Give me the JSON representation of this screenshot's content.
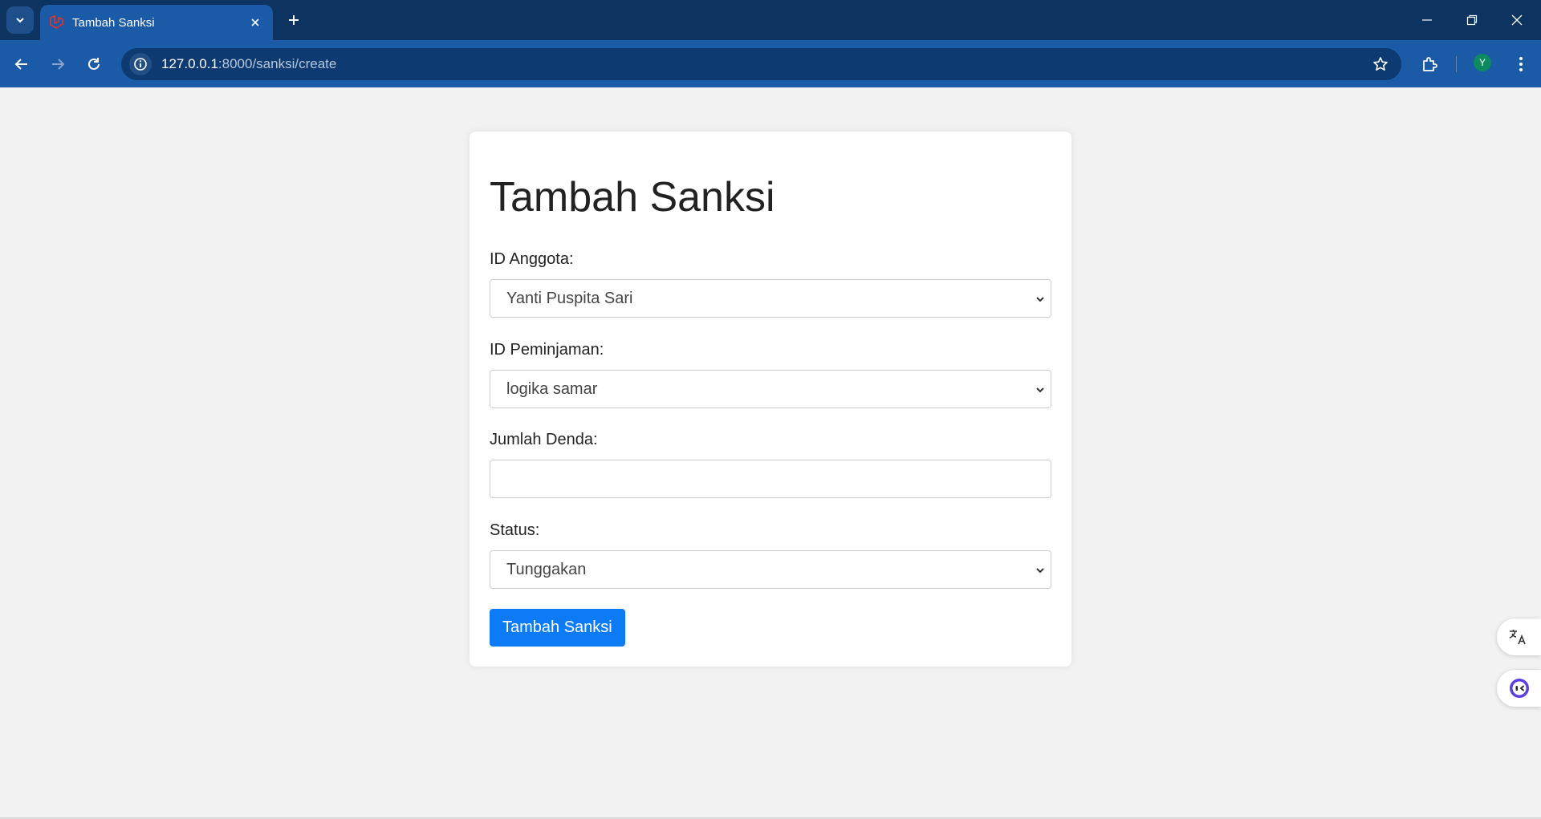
{
  "browser": {
    "tab_title": "Tambah Sanksi",
    "url_host": "127.0.0.1",
    "url_path": ":8000/sanksi/create",
    "profile_initial": "Y"
  },
  "form": {
    "title": "Tambah Sanksi",
    "anggota_label": "ID Anggota:",
    "anggota_value": "Yanti Puspita Sari",
    "peminjaman_label": "ID Peminjaman:",
    "peminjaman_value": "logika samar",
    "denda_label": "Jumlah Denda:",
    "denda_value": "",
    "status_label": "Status:",
    "status_value": "Tunggakan",
    "submit_label": "Tambah Sanksi"
  },
  "colors": {
    "tabbar": "#0d3361",
    "toolbar": "#1a5aa6",
    "button": "#0d7bf5"
  },
  "icons": [
    "chevron-down-icon",
    "laravel-icon",
    "close-icon",
    "plus-icon",
    "minimize-icon",
    "restore-icon",
    "back-arrow-icon",
    "forward-arrow-icon",
    "reload-icon",
    "info-icon",
    "star-icon",
    "puzzle-icon",
    "kebab-menu-icon",
    "translate-icon",
    "assistant-icon"
  ]
}
